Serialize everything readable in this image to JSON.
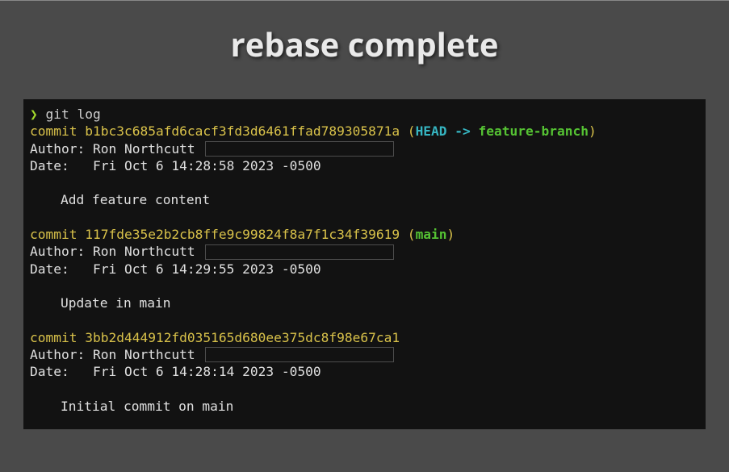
{
  "title": "rebase complete",
  "prompt_symbol": "❯",
  "command": " git log",
  "commits": [
    {
      "label": "commit ",
      "hash": "b1bc3c685afd6cacf3fd3d6461ffad789305871a",
      "ref_open": " (",
      "head": "HEAD -> ",
      "branch": "feature-branch",
      "ref_close": ")",
      "author_prefix": "Author: Ron Northcutt ",
      "date": "Date:   Fri Oct 6 14:28:58 2023 -0500",
      "message": "Add feature content"
    },
    {
      "label": "commit ",
      "hash": "117fde35e2b2cb8ffe9c99824f8a7f1c34f39619",
      "ref_open": " (",
      "head": "",
      "branch": "main",
      "ref_close": ")",
      "author_prefix": "Author: Ron Northcutt ",
      "date": "Date:   Fri Oct 6 14:29:55 2023 -0500",
      "message": "Update in main"
    },
    {
      "label": "commit ",
      "hash": "3bb2d444912fd035165d680ee375dc8f98e67ca1",
      "ref_open": "",
      "head": "",
      "branch": "",
      "ref_close": "",
      "author_prefix": "Author: Ron Northcutt ",
      "date": "Date:   Fri Oct 6 14:28:14 2023 -0500",
      "message": "Initial commit on main"
    }
  ]
}
